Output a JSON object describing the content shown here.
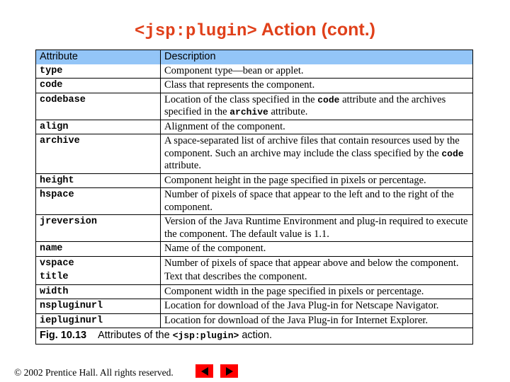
{
  "slide": {
    "title_code": "<jsp:plugin>",
    "title_rest": " Action (cont.)"
  },
  "table": {
    "headers": {
      "attribute": "Attribute",
      "description": "Description"
    },
    "rows": [
      {
        "attribute": "type",
        "ruled": false,
        "desc_parts": [
          {
            "t": "Component type—bean or applet."
          }
        ]
      },
      {
        "attribute": "code",
        "ruled": true,
        "desc_parts": [
          {
            "t": "Class that represents the component."
          }
        ]
      },
      {
        "attribute": "codebase",
        "ruled": true,
        "desc_parts": [
          {
            "t": "Location of the class specified in the "
          },
          {
            "t": "code",
            "code": true
          },
          {
            "t": " attribute and the archives specified in the "
          },
          {
            "t": "archive",
            "code": true
          },
          {
            "t": " attribute."
          }
        ]
      },
      {
        "attribute": "align",
        "ruled": true,
        "desc_parts": [
          {
            "t": "Alignment of the component."
          }
        ]
      },
      {
        "attribute": "archive",
        "ruled": true,
        "desc_parts": [
          {
            "t": "A space-separated list of archive files that contain resources used by the component. Such an archive may include the class specified by the "
          },
          {
            "t": "code",
            "code": true
          },
          {
            "t": " attribute."
          }
        ]
      },
      {
        "attribute": "height",
        "ruled": true,
        "desc_parts": [
          {
            "t": "Component height in the page specified in pixels or percentage."
          }
        ]
      },
      {
        "attribute": "hspace",
        "ruled": true,
        "desc_parts": [
          {
            "t": "Number of pixels of space that appear to the left and to the right of the component."
          }
        ]
      },
      {
        "attribute": "jreversion",
        "ruled": true,
        "desc_parts": [
          {
            "t": "Version of the Java Runtime Environment and plug-in required to execute the component. The default value is 1.1."
          }
        ]
      },
      {
        "attribute": "name",
        "ruled": true,
        "desc_parts": [
          {
            "t": "Name of the component."
          }
        ]
      },
      {
        "attribute": "vspace",
        "ruled": true,
        "desc_parts": [
          {
            "t": "Number of pixels of space that appear above and below the component."
          }
        ]
      },
      {
        "attribute": "title",
        "ruled": false,
        "desc_parts": [
          {
            "t": "Text that describes the component."
          }
        ]
      },
      {
        "attribute": "width",
        "ruled": true,
        "desc_parts": [
          {
            "t": "Component width in the page specified in pixels or percentage."
          }
        ]
      },
      {
        "attribute": "nspluginurl",
        "ruled": true,
        "desc_parts": [
          {
            "t": "Location for download of the Java Plug-in for Netscape Navigator."
          }
        ]
      },
      {
        "attribute": "iepluginurl",
        "ruled": true,
        "desc_parts": [
          {
            "t": "Location for download of the Java Plug-in for Internet Explorer."
          }
        ]
      }
    ],
    "caption": {
      "label": "Fig. 10.13",
      "text_before": "Attributes of the ",
      "code": "<jsp:plugin>",
      "text_after": " action."
    }
  },
  "footer": {
    "copyright": "© 2002 Prentice Hall.  All rights reserved.",
    "prev_label": "previous-slide",
    "next_label": "next-slide"
  }
}
